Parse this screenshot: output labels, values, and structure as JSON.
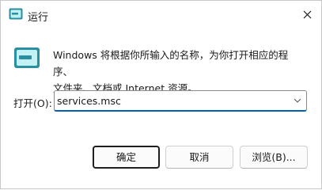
{
  "window": {
    "title": "运行"
  },
  "icons": {
    "title": "run-icon",
    "main": "run-icon",
    "close": "close-icon",
    "dropdown": "chevron-down-icon"
  },
  "description": {
    "line1": "Windows 将根据你所输入的名称，为你打开相应的程序、",
    "line2": "文件夹、文档或 Internet 资源。"
  },
  "open_field": {
    "label": "打开(O):",
    "value": "services.msc"
  },
  "buttons": {
    "ok": "确定",
    "cancel": "取消",
    "browse": "浏览(B)..."
  },
  "colors": {
    "accent": "#005fb8",
    "icon_teal": "#1f9aa6"
  }
}
